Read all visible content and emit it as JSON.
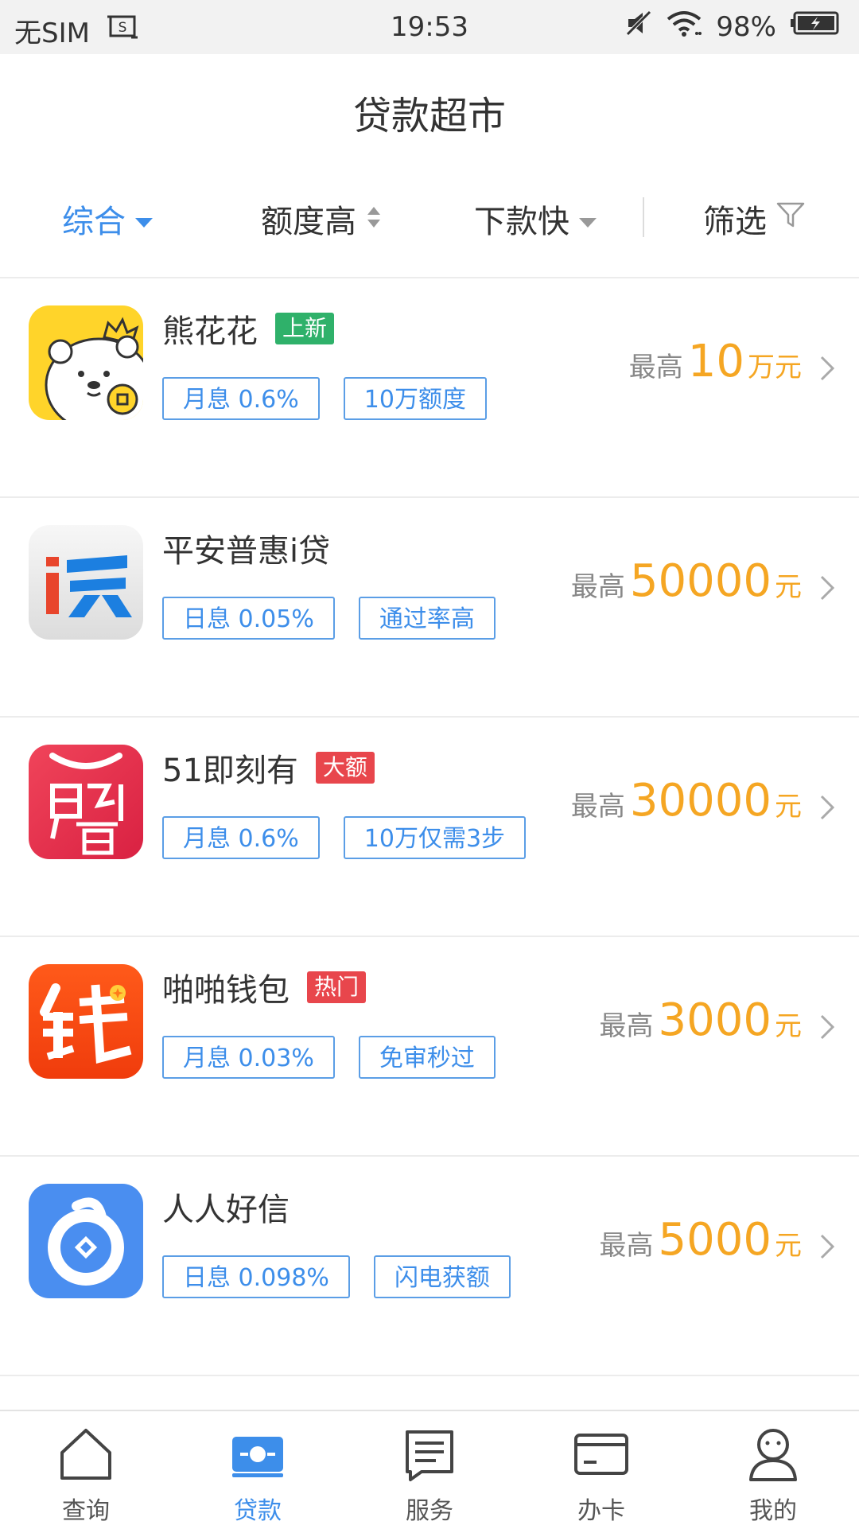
{
  "status_bar": {
    "carrier": "无SIM",
    "time": "19:53",
    "battery": "98%"
  },
  "header": {
    "title": "贷款超市"
  },
  "sort_bar": {
    "items": [
      {
        "label": "综合",
        "active": true
      },
      {
        "label": "额度高",
        "active": false
      },
      {
        "label": "下款快",
        "active": false
      },
      {
        "label": "筛选",
        "active": false
      }
    ]
  },
  "loans": [
    {
      "name": "熊花花",
      "badge": "上新",
      "badge_color": "#2fb16a",
      "tags": [
        "月息 0.6%",
        "10万额度"
      ],
      "amount_prefix": "最高",
      "amount": "10",
      "amount_unit": "万元",
      "icon": "bear-icon"
    },
    {
      "name": "平安普惠i贷",
      "badge": "",
      "tags": [
        "日息 0.05%",
        "通过率高"
      ],
      "amount_prefix": "最高",
      "amount": "50000",
      "amount_unit": "元",
      "icon": "dai-icon"
    },
    {
      "name": "51即刻有",
      "badge": "大额",
      "badge_color": "#e8464c",
      "tags": [
        "月息 0.6%",
        "10万仅需3步"
      ],
      "amount_prefix": "最高",
      "amount": "30000",
      "amount_unit": "元",
      "icon": "jikeyou-icon"
    },
    {
      "name": "啪啪钱包",
      "badge": "热门",
      "badge_color": "#e8464c",
      "tags": [
        "月息 0.03%",
        "免审秒过"
      ],
      "amount_prefix": "最高",
      "amount": "3000",
      "amount_unit": "元",
      "icon": "qian-icon"
    },
    {
      "name": "人人好信",
      "badge": "",
      "tags": [
        "日息 0.098%",
        "闪电获额"
      ],
      "amount_prefix": "最高",
      "amount": "5000",
      "amount_unit": "元",
      "icon": "coin-ring-icon"
    }
  ],
  "bottom_nav": {
    "items": [
      {
        "label": "查询",
        "icon": "home-icon",
        "active": false
      },
      {
        "label": "贷款",
        "icon": "loan-icon",
        "active": true
      },
      {
        "label": "服务",
        "icon": "document-icon",
        "active": false
      },
      {
        "label": "办卡",
        "icon": "card-icon",
        "active": false
      },
      {
        "label": "我的",
        "icon": "user-icon",
        "active": false
      }
    ]
  },
  "colors": {
    "accent": "#3d8eea",
    "amount": "#f5a623",
    "divider": "#ececec"
  }
}
